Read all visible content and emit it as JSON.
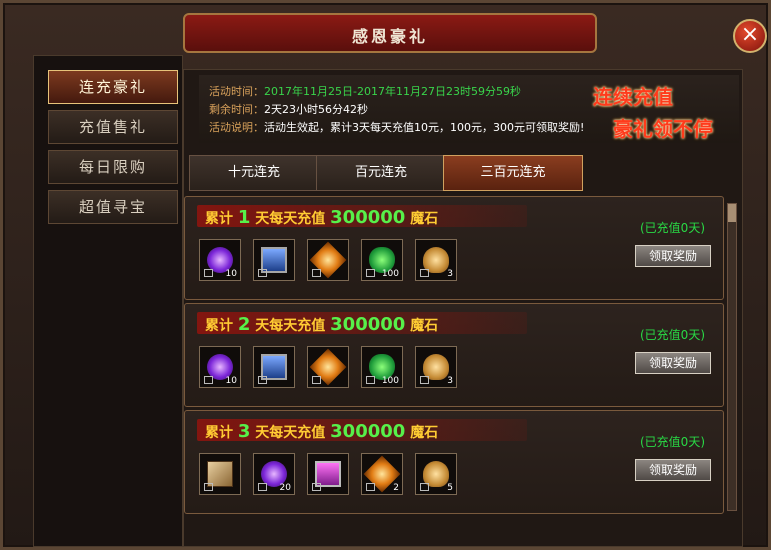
{
  "window": {
    "title": "感恩豪礼",
    "close_label": "×"
  },
  "sidebar": {
    "items": [
      {
        "label": "连充豪礼",
        "active": true
      },
      {
        "label": "充值售礼",
        "active": false
      },
      {
        "label": "每日限购",
        "active": false
      },
      {
        "label": "超值寻宝",
        "active": false
      }
    ]
  },
  "info": {
    "time_label": "活动时间：",
    "time_value": "2017年11月25日-2017年11月27日23时59分59秒",
    "remain_label": "剩余时间：",
    "remain_value": "2天23小时56分42秒",
    "desc_label": "活动说明：",
    "desc_value": "活动生效起，累计3天每天充值10元，100元，300元可领取奖励!"
  },
  "slogans": [
    "连续充值",
    "豪礼领不停"
  ],
  "tabs": [
    {
      "label": "十元连充",
      "active": false
    },
    {
      "label": "百元连充",
      "active": false
    },
    {
      "label": "三百元连充",
      "active": true
    }
  ],
  "rewards": [
    {
      "prefix": "累计",
      "days": "1",
      "middle": "天每天充值",
      "amount": "300000",
      "suffix": "魔石",
      "status": "(已充值0天)",
      "button": "领取奖励",
      "items": [
        {
          "icon": "purple-orb-icon",
          "count": "10"
        },
        {
          "icon": "blue-chest-icon",
          "count": ""
        },
        {
          "icon": "fire-crystal-icon",
          "count": ""
        },
        {
          "icon": "clover-icon",
          "count": "100"
        },
        {
          "icon": "gold-bag-icon",
          "count": "3"
        }
      ]
    },
    {
      "prefix": "累计",
      "days": "2",
      "middle": "天每天充值",
      "amount": "300000",
      "suffix": "魔石",
      "status": "(已充值0天)",
      "button": "领取奖励",
      "items": [
        {
          "icon": "purple-orb-icon",
          "count": "10"
        },
        {
          "icon": "blue-chest-icon",
          "count": ""
        },
        {
          "icon": "fire-crystal-icon",
          "count": ""
        },
        {
          "icon": "clover-icon",
          "count": "100"
        },
        {
          "icon": "gold-bag-icon",
          "count": "3"
        }
      ]
    },
    {
      "prefix": "累计",
      "days": "3",
      "middle": "天每天充值",
      "amount": "300000",
      "suffix": "魔石",
      "status": "(已充值0天)",
      "button": "领取奖励",
      "items": [
        {
          "icon": "scroll-card-icon",
          "count": ""
        },
        {
          "icon": "purple-orb-icon",
          "count": "20"
        },
        {
          "icon": "purple-chest-icon",
          "count": ""
        },
        {
          "icon": "fire-crystal-icon",
          "count": "2"
        },
        {
          "icon": "gold-bag-icon",
          "count": "5"
        }
      ]
    }
  ]
}
